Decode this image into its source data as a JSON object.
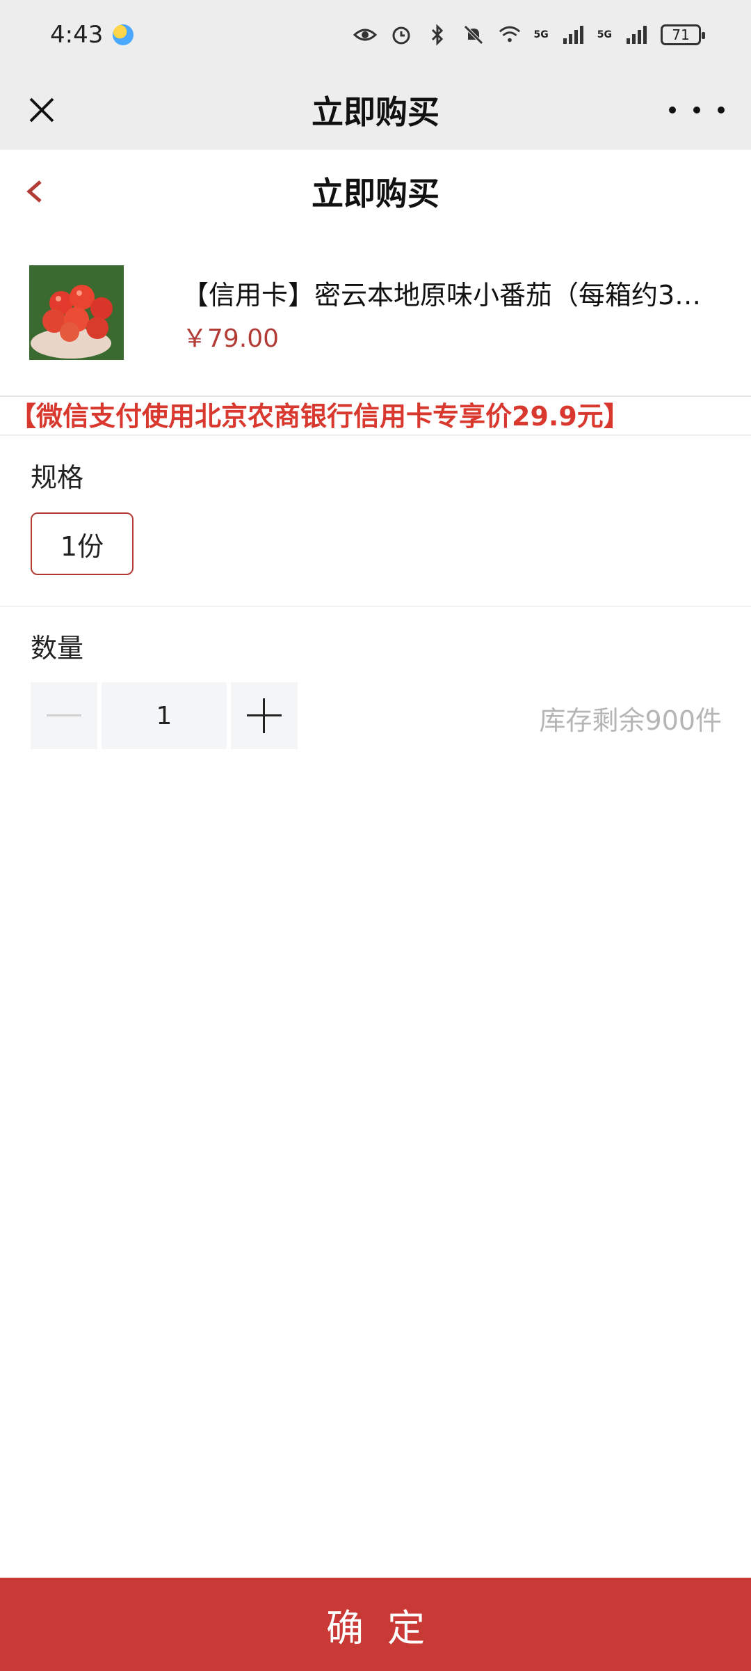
{
  "status_bar": {
    "time": "4:43",
    "battery": "71",
    "network_1": "5G",
    "network_2": "5G"
  },
  "title_bar": {
    "title": "立即购买"
  },
  "page_header": {
    "title": "立即购买"
  },
  "product": {
    "name": "【信用卡】密云本地原味小番茄（每箱约3…",
    "price": "￥79.00"
  },
  "promo": "【微信支付使用北京农商银行信用卡专享价29.9元】",
  "spec": {
    "label": "规格",
    "option": "1份"
  },
  "quantity": {
    "label": "数量",
    "value": "1",
    "stock": "库存剩余900件"
  },
  "confirm_label": "确定",
  "colors": {
    "accent": "#c93935",
    "price": "#b23b35",
    "promo": "#d8382e"
  }
}
